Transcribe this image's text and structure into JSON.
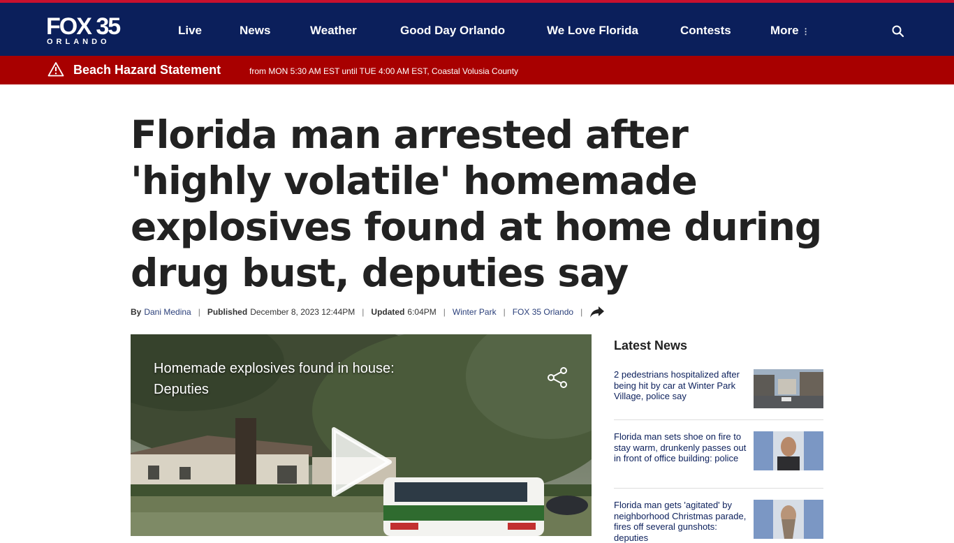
{
  "brand": {
    "name": "FOX 35",
    "sub": "ORLANDO"
  },
  "nav": {
    "items": [
      "Live",
      "News",
      "Weather",
      "Good Day Orlando",
      "We Love Florida",
      "Contests",
      "More"
    ]
  },
  "alert": {
    "title": "Beach Hazard Statement",
    "detail": "from MON 5:30 AM EST until TUE 4:00 AM EST, Coastal Volusia County"
  },
  "article": {
    "headline": "Florida man arrested after 'highly volatile' homemade explosives found at home during drug bust, deputies say",
    "byline": {
      "by_label": "By",
      "author": "Dani Medina",
      "published_label": "Published",
      "published": "December 8, 2023 12:44PM",
      "updated_label": "Updated",
      "updated": "6:04PM",
      "tag": "Winter Park",
      "source": "FOX 35 Orlando"
    }
  },
  "video": {
    "title": "Homemade explosives found in house: Deputies",
    "icons": {
      "share": "share-icon",
      "play": "play-icon"
    }
  },
  "sidebar": {
    "title": "Latest News",
    "items": [
      {
        "text": "2 pedestrians hospitalized after being hit by car at Winter Park Village, police say"
      },
      {
        "text": "Florida man sets shoe on fire to stay warm, drunkenly passes out in front of office building: police"
      },
      {
        "text": "Florida man gets 'agitated' by neighborhood Christmas parade, fires off several gunshots: deputies"
      }
    ]
  },
  "colors": {
    "header": "#0b1f5b",
    "alert": "#a80000",
    "accent": "#c8102e"
  }
}
